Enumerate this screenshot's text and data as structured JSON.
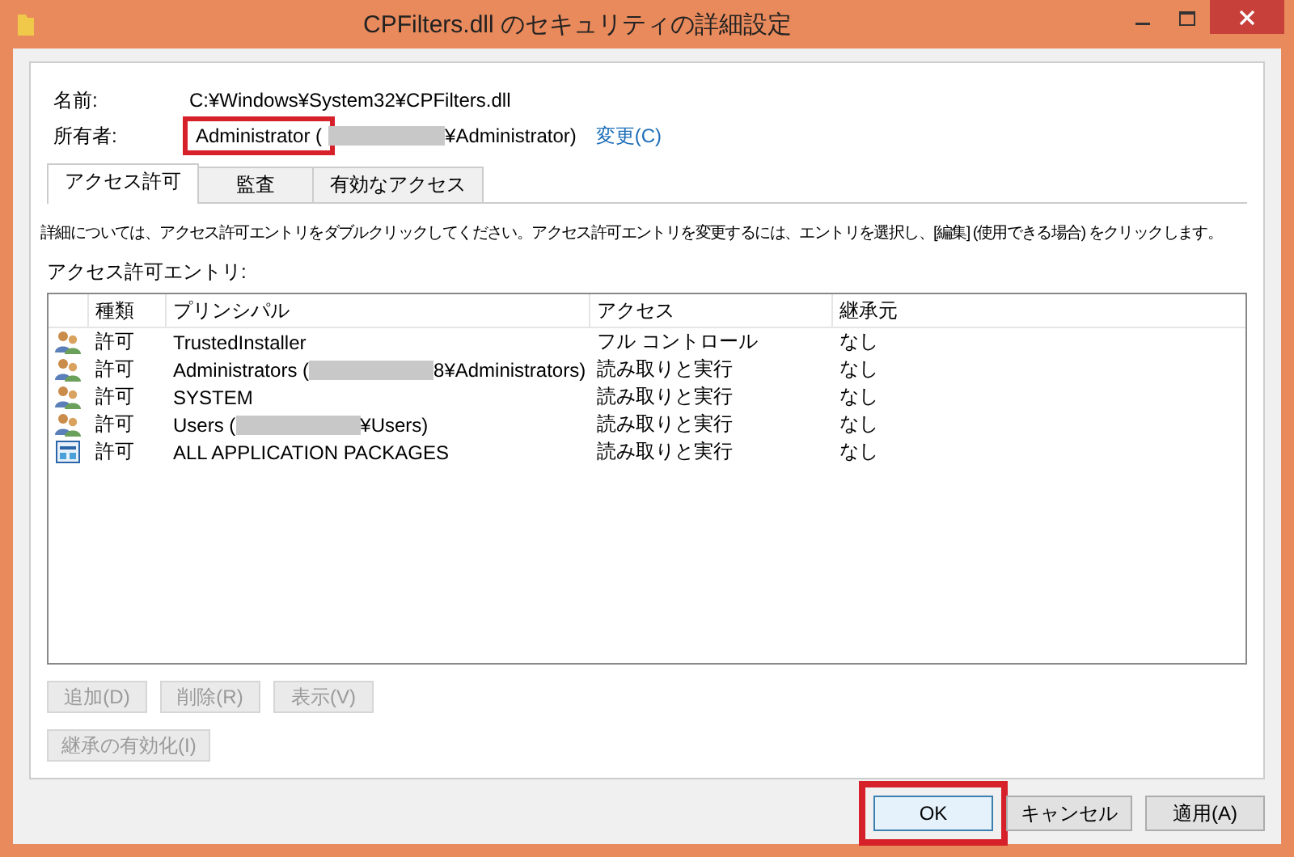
{
  "window": {
    "title": "CPFilters.dll のセキュリティの詳細設定"
  },
  "name": {
    "label": "名前:",
    "value": "C:¥Windows¥System32¥CPFilters.dll"
  },
  "owner": {
    "label": "所有者:",
    "value_start": "Administrator (",
    "redacted": true,
    "value_end": "¥Administrator)",
    "highlighted": true,
    "change_link": "変更(C)"
  },
  "tabs": [
    {
      "label": "アクセス許可",
      "selected": true
    },
    {
      "label": "監査",
      "selected": false
    },
    {
      "label": "有効なアクセス",
      "selected": false
    }
  ],
  "description": "詳細については、アクセス許可エントリをダブルクリックしてください。アクセス許可エントリを変更するには、エントリを選択し、[編集] (使用できる場合) をクリックします。",
  "entries_label": "アクセス許可エントリ:",
  "table": {
    "columns": [
      "種類",
      "プリンシパル",
      "アクセス",
      "継承元"
    ],
    "rows": [
      {
        "kind": "group",
        "type": "許可",
        "principal_start": "TrustedInstaller",
        "redacted": false,
        "access": "フル コントロール",
        "inherited_from": "なし"
      },
      {
        "kind": "group",
        "type": "許可",
        "principal_start": "Administrators (",
        "redacted": true,
        "principal_end": "8¥Administrators)",
        "access": "読み取りと実行",
        "inherited_from": "なし"
      },
      {
        "kind": "group",
        "type": "許可",
        "principal_start": "SYSTEM",
        "redacted": false,
        "access": "読み取りと実行",
        "inherited_from": "なし"
      },
      {
        "kind": "group",
        "type": "許可",
        "principal_start": "Users (",
        "redacted": true,
        "principal_end": "¥Users)",
        "access": "読み取りと実行",
        "inherited_from": "なし"
      },
      {
        "kind": "package",
        "type": "許可",
        "principal_start": "ALL APPLICATION PACKAGES",
        "redacted": false,
        "access": "読み取りと実行",
        "inherited_from": "なし"
      }
    ]
  },
  "entry_buttons": [
    {
      "label": "追加(D)",
      "disabled": true
    },
    {
      "label": "削除(R)",
      "disabled": true
    },
    {
      "label": "表示(V)",
      "disabled": true
    }
  ],
  "inheritance_button": {
    "label": "継承の有効化(I)",
    "disabled": true
  },
  "dialog_buttons": [
    {
      "label": "OK",
      "highlighted": true,
      "default": true
    },
    {
      "label": "キャンセル",
      "highlighted": false,
      "default": false
    },
    {
      "label": "適用(A)",
      "highlighted": false,
      "default": false
    }
  ]
}
